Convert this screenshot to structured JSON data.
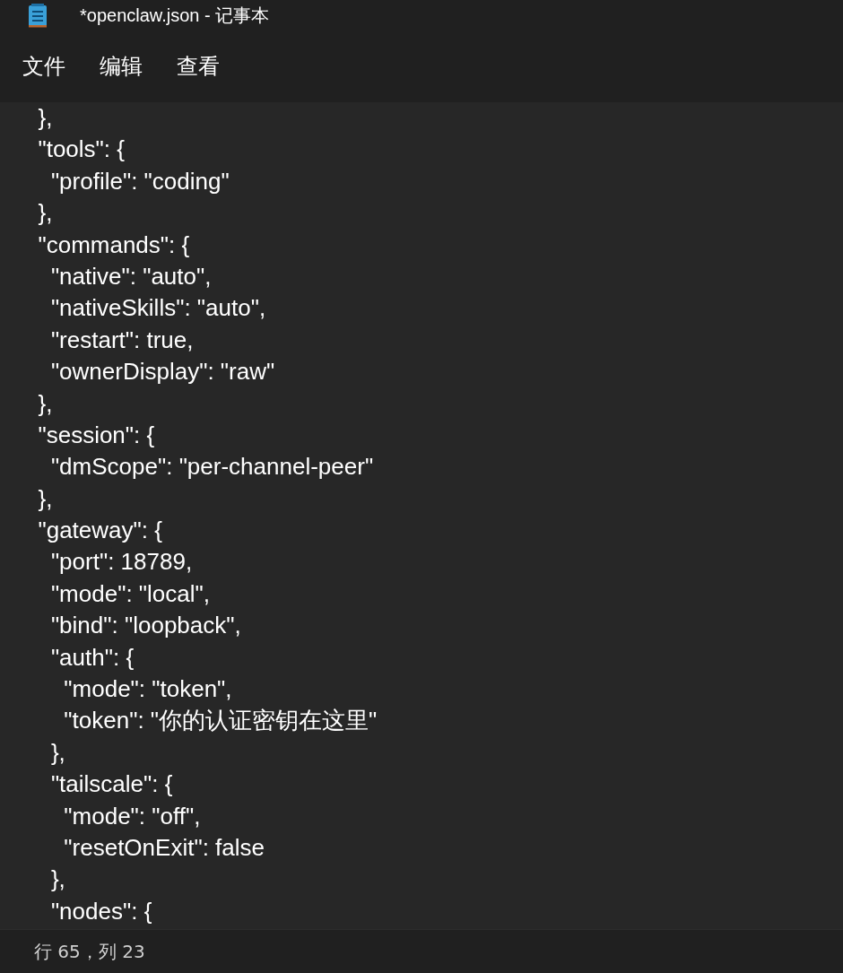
{
  "window": {
    "title": "*openclaw.json - 记事本"
  },
  "menu": [
    "文件",
    "编辑",
    "查看"
  ],
  "lines": [
    "  },",
    "  \"tools\": {",
    "    \"profile\": \"coding\"",
    "  },",
    "  \"commands\": {",
    "    \"native\": \"auto\",",
    "    \"nativeSkills\": \"auto\",",
    "    \"restart\": true,",
    "    \"ownerDisplay\": \"raw\"",
    "  },",
    "  \"session\": {",
    "    \"dmScope\": \"per-channel-peer\"",
    "  },",
    "  \"gateway\": {",
    "    \"port\": 18789,",
    "    \"mode\": \"local\",",
    "    \"bind\": \"loopback\",",
    "    \"auth\": {",
    "      \"mode\": \"token\",",
    "      \"token\": \"你的认证密钥在这里\"",
    "    },",
    "    \"tailscale\": {",
    "      \"mode\": \"off\",",
    "      \"resetOnExit\": false",
    "    },",
    "    \"nodes\": {"
  ],
  "status_bar": "行 65，列 23"
}
